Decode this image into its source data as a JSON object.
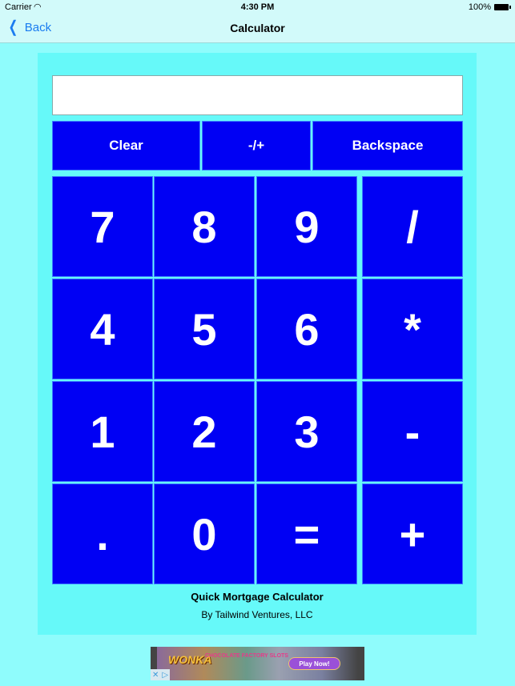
{
  "status_bar": {
    "carrier": "Carrier",
    "wifi_icon": "wifi-icon",
    "time": "4:30 PM",
    "battery_percent": "100%",
    "battery_icon": "battery-icon"
  },
  "nav": {
    "back_label": "Back",
    "back_icon": "chevron-left-icon",
    "title": "Calculator"
  },
  "calculator": {
    "display_value": "",
    "top_row": [
      {
        "label": "Clear"
      },
      {
        "label": "-/+"
      },
      {
        "label": "Backspace"
      }
    ],
    "keys": [
      [
        "7",
        "8",
        "9",
        "/"
      ],
      [
        "4",
        "5",
        "6",
        "*"
      ],
      [
        "1",
        "2",
        "3",
        "-"
      ],
      [
        ".",
        "0",
        "=",
        "+"
      ]
    ]
  },
  "footer": {
    "title": "Quick Mortgage Calculator",
    "subtitle": "By Tailwind Ventures, LLC"
  },
  "ad": {
    "brand": "WONKA",
    "sub": "CHOCOLATE FACTORY SLOTS",
    "cta": "Play Now!",
    "close_icon": "close-icon",
    "adchoices_icon": "adchoices-icon"
  },
  "colors": {
    "background": "#8ffcfc",
    "panel": "#66f9f9",
    "button": "#0000f4",
    "button_text": "#ffffff",
    "nav_bar": "#d2fafa",
    "accent": "#1a7cf0"
  }
}
